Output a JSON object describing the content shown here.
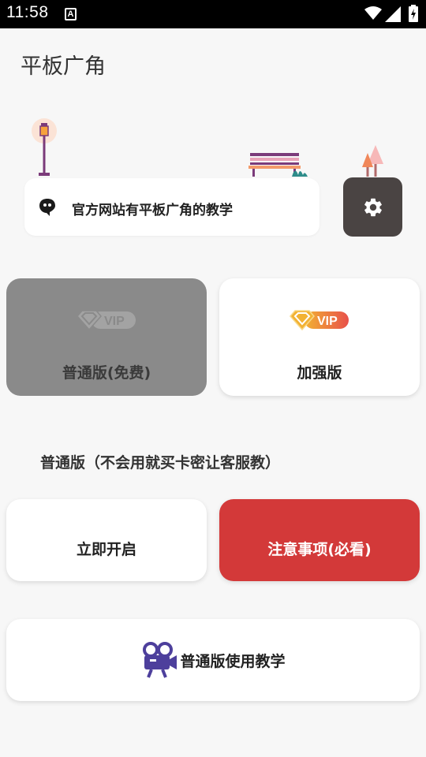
{
  "status_bar": {
    "time": "11:58",
    "notification_icon": "A",
    "icons": [
      "wifi-icon",
      "signal-icon",
      "battery-icon"
    ]
  },
  "app": {
    "title": "平板广角"
  },
  "notice": {
    "text": "官方网站有平板广角的教学",
    "icon": "quote-bubble-icon"
  },
  "settings": {
    "icon": "gear-icon"
  },
  "versions": {
    "free_label": "普通版(免费)",
    "plus_label": "加强版",
    "badge_text": "VIP"
  },
  "section": {
    "heading": "普通版（不会用就买卡密让客服教）"
  },
  "actions": {
    "start_label": "立即开启",
    "notes_label": "注意事项(必看)",
    "tutorial_label": "普通版使用教学",
    "tutorial_icon": "video-camera-icon"
  },
  "colors": {
    "danger": "#d33939",
    "settings_bg": "#4a4443",
    "free_tile_bg": "#8a8a8a",
    "vip_gold": "#f2b233",
    "vip_red": "#e8504a",
    "camera_purple": "#4d3f9c"
  }
}
